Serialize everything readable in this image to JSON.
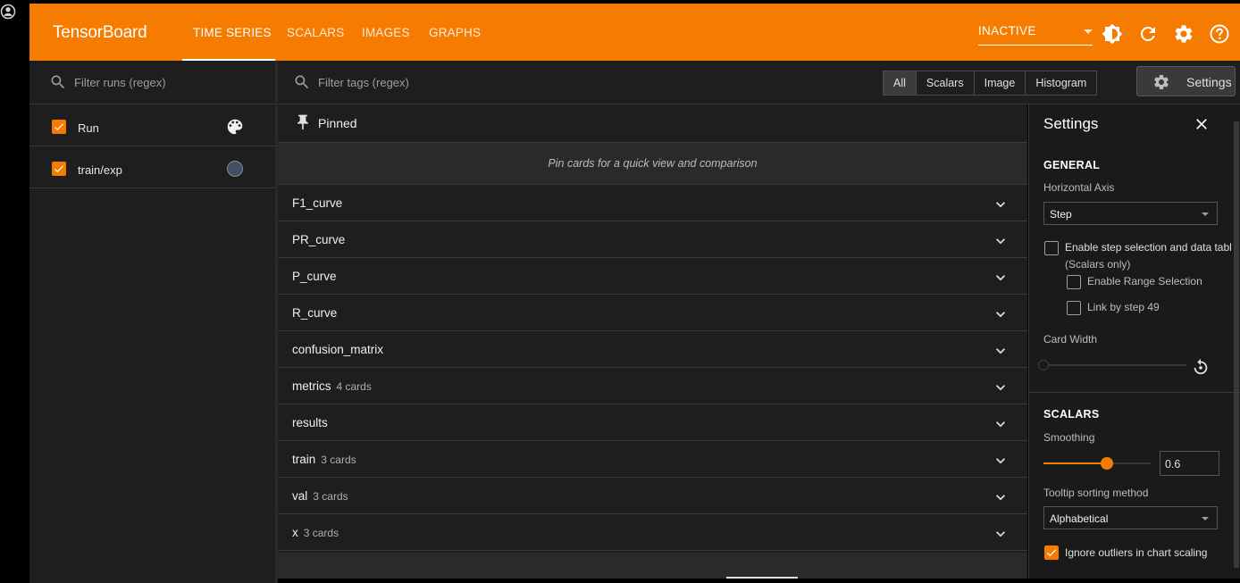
{
  "topbar": {
    "brand": "TensorBoard",
    "tabs": [
      "TIME SERIES",
      "SCALARS",
      "IMAGES",
      "GRAPHS"
    ],
    "status_select": "INACTIVE"
  },
  "runs": {
    "filter_placeholder": "Filter runs (regex)",
    "items": [
      {
        "label": "Run",
        "checked": true
      },
      {
        "label": "train/exp",
        "checked": true,
        "color": "#425066"
      }
    ]
  },
  "main": {
    "filter_placeholder": "Filter tags (regex)",
    "types": [
      "All",
      "Scalars",
      "Image",
      "Histogram"
    ],
    "settings_button": "Settings",
    "pinned_label": "Pinned",
    "pinned_empty": "Pin cards for a quick view and comparison",
    "groups": [
      {
        "name": "F1_curve",
        "count": ""
      },
      {
        "name": "PR_curve",
        "count": ""
      },
      {
        "name": "P_curve",
        "count": ""
      },
      {
        "name": "R_curve",
        "count": ""
      },
      {
        "name": "confusion_matrix",
        "count": ""
      },
      {
        "name": "metrics",
        "count": "4 cards"
      },
      {
        "name": "results",
        "count": ""
      },
      {
        "name": "train",
        "count": "3 cards"
      },
      {
        "name": "val",
        "count": "3 cards"
      },
      {
        "name": "x",
        "count": "3 cards"
      }
    ]
  },
  "settings": {
    "title": "Settings",
    "general": "GENERAL",
    "horizontal_axis_label": "Horizontal Axis",
    "horizontal_axis_value": "Step",
    "step_selection": "Enable step selection and data tabl",
    "scalars_only": "(Scalars only)",
    "range_selection": "Enable Range Selection",
    "link_by_step": "Link by step 49",
    "card_width": "Card Width",
    "scalars": "SCALARS",
    "smoothing_label": "Smoothing",
    "smoothing_value": "0.6",
    "tooltip_label": "Tooltip sorting method",
    "tooltip_value": "Alphabetical",
    "ignore_outliers": "Ignore outliers in chart scaling"
  },
  "colors": {
    "accent": "#f57c00",
    "run_color": "#425066"
  }
}
